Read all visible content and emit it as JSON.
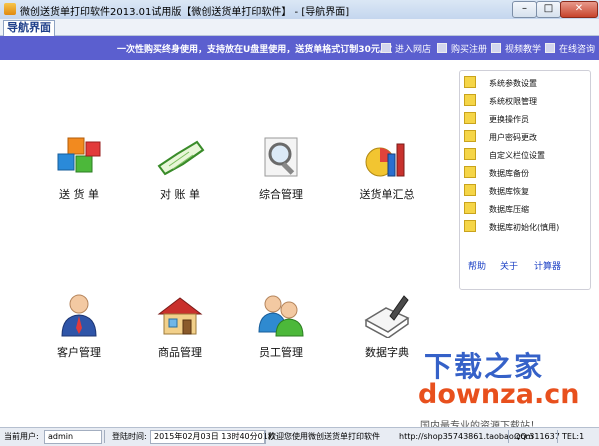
{
  "window": {
    "title": "微创送货单打印软件2013.01试用版【微创送货单打印软件】 - [导航界面]",
    "min": "–",
    "max": "□",
    "close": "✕"
  },
  "tab": {
    "label": "导航界面"
  },
  "banner": {
    "slogan": "一次性购买终身使用，支持放在U盘里使用，送货单格式订制30元/次",
    "links": [
      "进入网店",
      "购买注册",
      "视频教学",
      "在线咨询"
    ]
  },
  "apps": [
    {
      "label": "送 货 单",
      "icon": "cubes-icon"
    },
    {
      "label": "对 账 单",
      "icon": "open-book-icon"
    },
    {
      "label": "综合管理",
      "icon": "magnifier-icon"
    },
    {
      "label": "送货单汇总",
      "icon": "bar-chart-icon"
    },
    {
      "label": "客户管理",
      "icon": "customer-person-icon"
    },
    {
      "label": "商品管理",
      "icon": "house-icon"
    },
    {
      "label": "员工管理",
      "icon": "people-icon"
    },
    {
      "label": "数据字典",
      "icon": "book-pen-icon"
    }
  ],
  "menu": {
    "items": [
      "系统参数设置",
      "系统权限管理",
      "更换操作员",
      "用户密码更改",
      "自定义栏位设置",
      "数据库备份",
      "数据库恢复",
      "数据库压缩",
      "数据库初始化(慎用)"
    ],
    "links": [
      "帮助",
      "关于",
      "计算器"
    ]
  },
  "status": {
    "user_label": "当前用户:",
    "user_value": "admin",
    "login_label": "登陆时间:",
    "login_value": "2015年02月03日 13时40分01秒",
    "welcome": "欢迎您使用微创送货单打印软件",
    "url": "http://shop35743861.taobao.com",
    "qq": "QQ:311637",
    "tel": "TEL:1"
  },
  "watermark": {
    "line1": "下载之家",
    "line2": "downza.cn",
    "line3": "国内最专业的资源下载站！"
  }
}
